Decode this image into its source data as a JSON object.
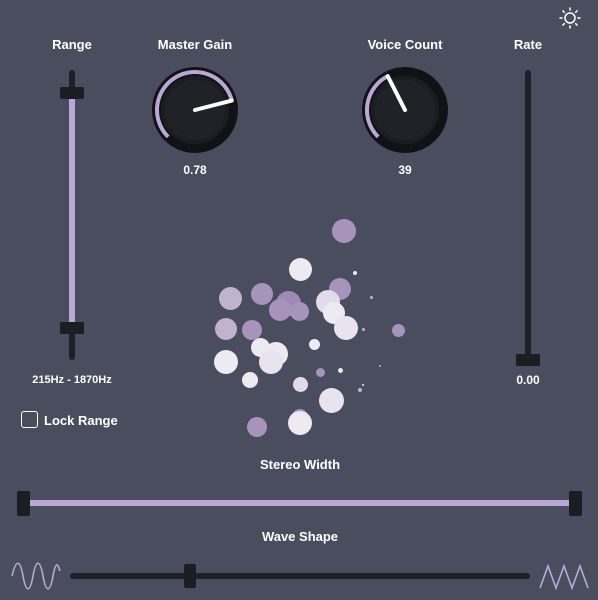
{
  "colors": {
    "background": "#4a4d5e",
    "accent": "#b9a8d6",
    "track": "#1e2026",
    "knob_body": "#1a1c20"
  },
  "settings_icon": "sun-icon",
  "range": {
    "label": "Range",
    "value_text": "215Hz - 1870Hz",
    "low": 0.11,
    "high": 0.92
  },
  "master_gain": {
    "label": "Master Gain",
    "value_text": "0.78",
    "value": 0.78
  },
  "voice_count": {
    "label": "Voice Count",
    "value_text": "39",
    "fraction": 0.4
  },
  "rate": {
    "label": "Rate",
    "value_text": "0.00",
    "value": 0.0
  },
  "lock_range": {
    "label": "Lock Range",
    "checked": false
  },
  "stereo_width": {
    "label": "Stereo Width",
    "low": 0.0,
    "high": 1.0
  },
  "wave_shape": {
    "label": "Wave Shape",
    "value": 0.26,
    "left_icon": "sine-wave-icon",
    "right_icon": "triangle-wave-icon"
  }
}
